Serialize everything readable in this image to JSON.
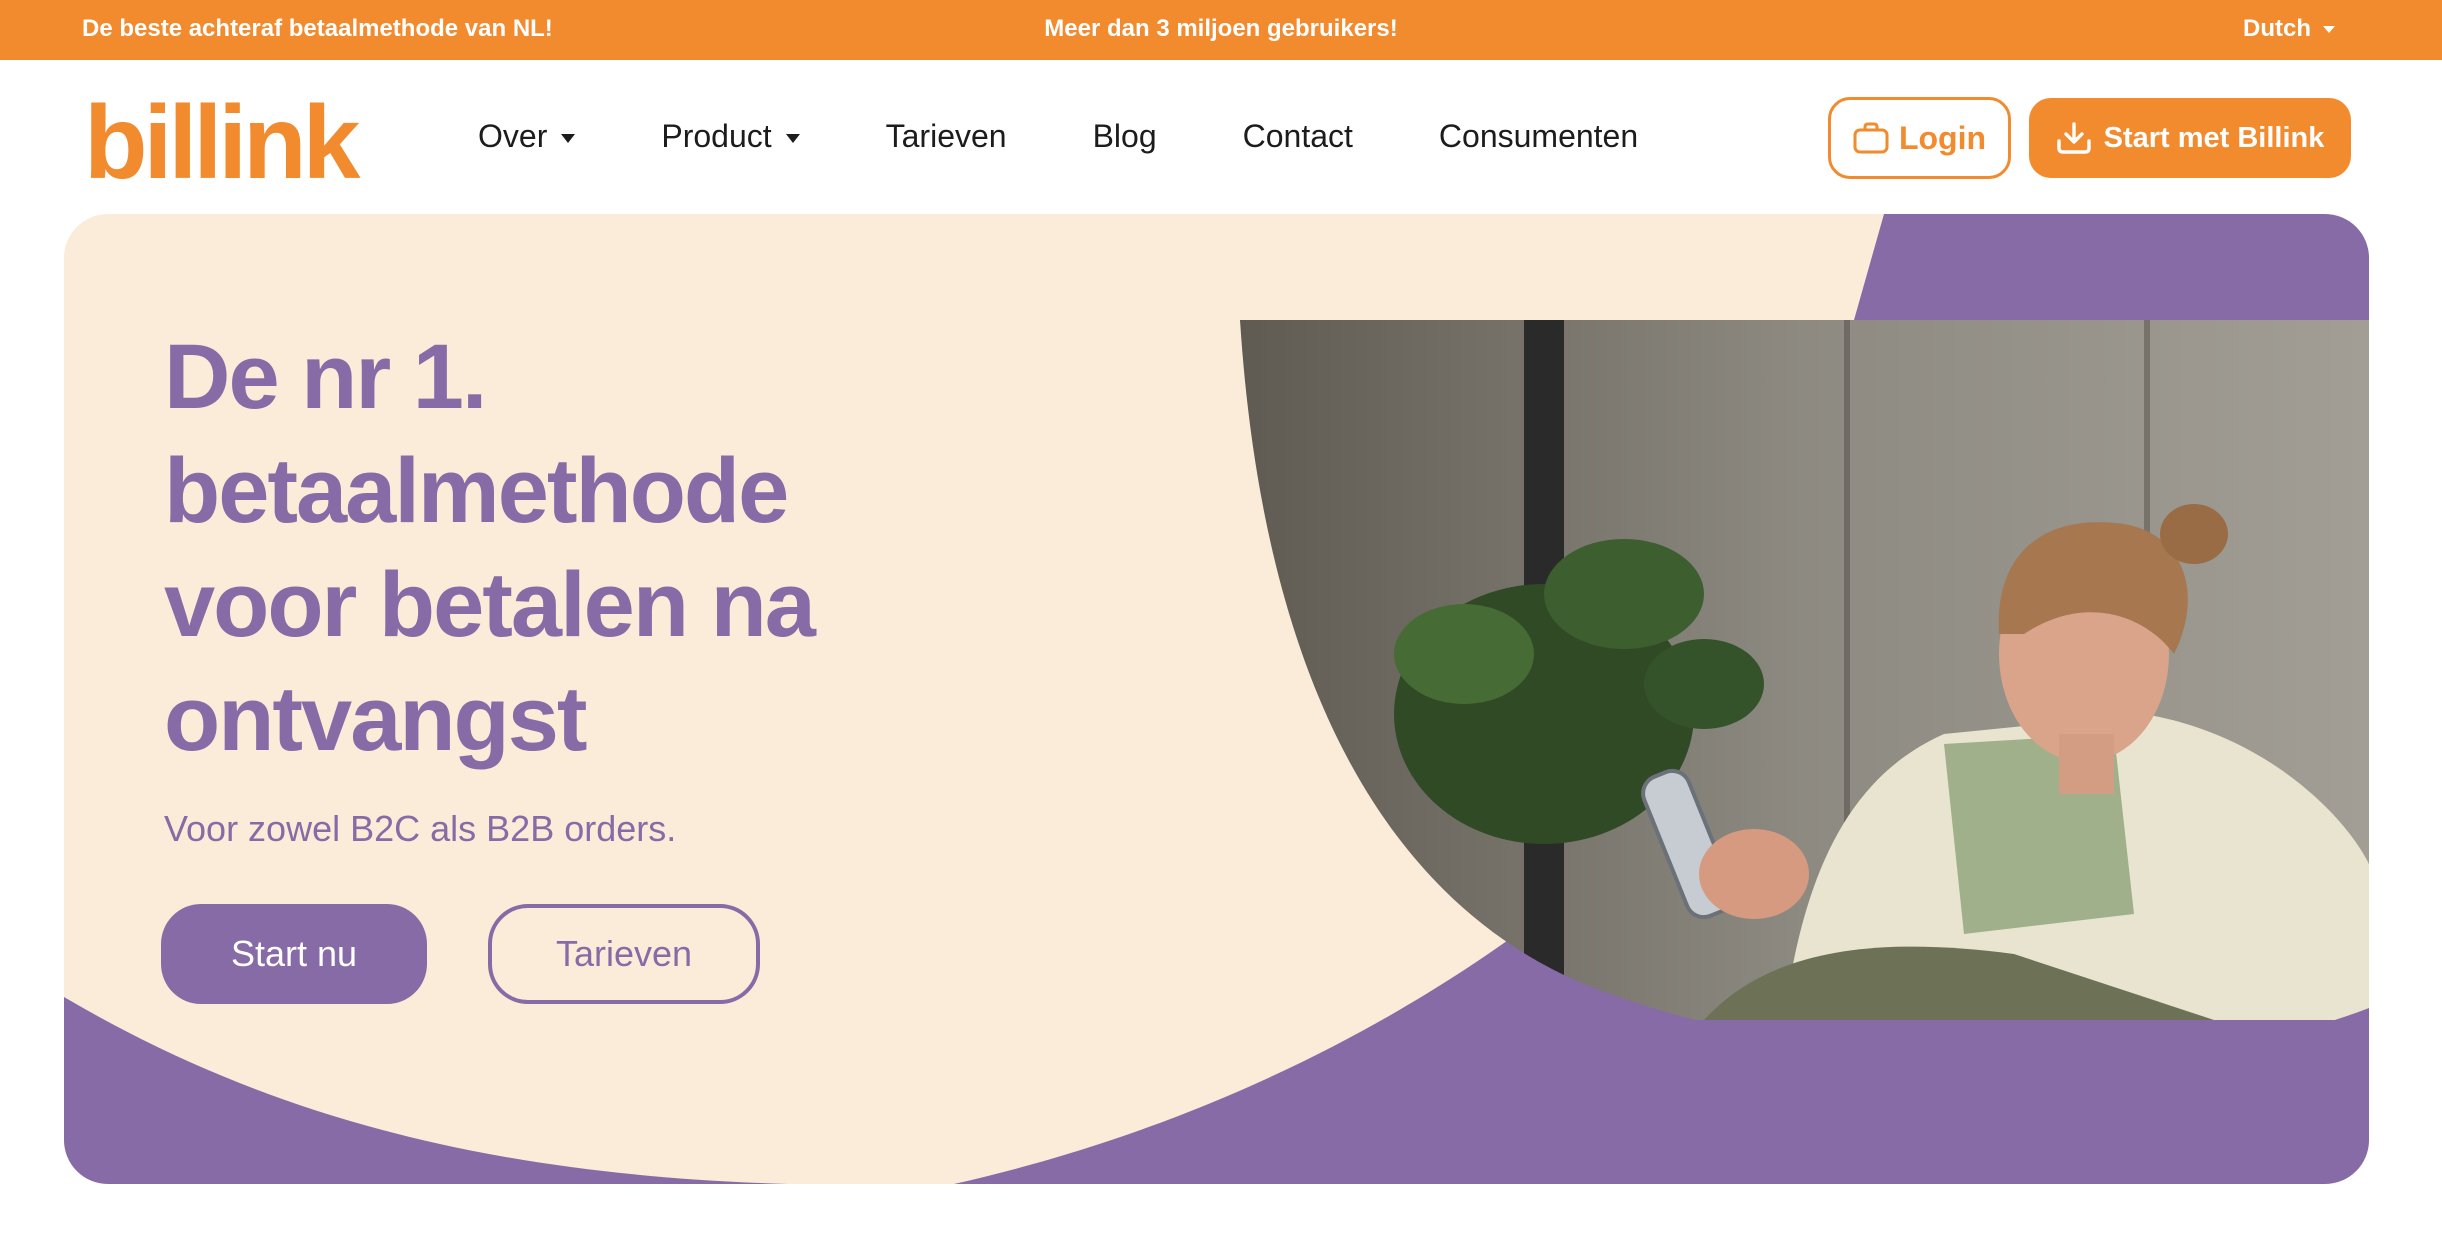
{
  "topbar": {
    "left_text": "De beste achteraf betaalmethode van NL!",
    "center_text": "Meer dan 3 miljoen gebruikers!",
    "language": "Dutch"
  },
  "brand": {
    "logo_text": "billink",
    "accent": "#f28a2e",
    "purple": "#876ba6",
    "cream": "#fbebd9"
  },
  "nav": {
    "items": [
      {
        "label": "Over",
        "dropdown": true
      },
      {
        "label": "Product",
        "dropdown": true
      },
      {
        "label": "Tarieven",
        "dropdown": false
      },
      {
        "label": "Blog",
        "dropdown": false
      },
      {
        "label": "Contact",
        "dropdown": false
      },
      {
        "label": "Consumenten",
        "dropdown": false
      }
    ],
    "login_label": "Login",
    "login_icon": "briefcase-icon",
    "start_label": "Start met Billink",
    "start_icon": "download-icon"
  },
  "hero": {
    "headline_lines": [
      "De nr 1.",
      "betaalmethode",
      "voor betalen na",
      "ontvangst"
    ],
    "subline": "Voor zowel B2C als B2B orders.",
    "primary_button": "Start nu",
    "secondary_button": "Tarieven"
  }
}
